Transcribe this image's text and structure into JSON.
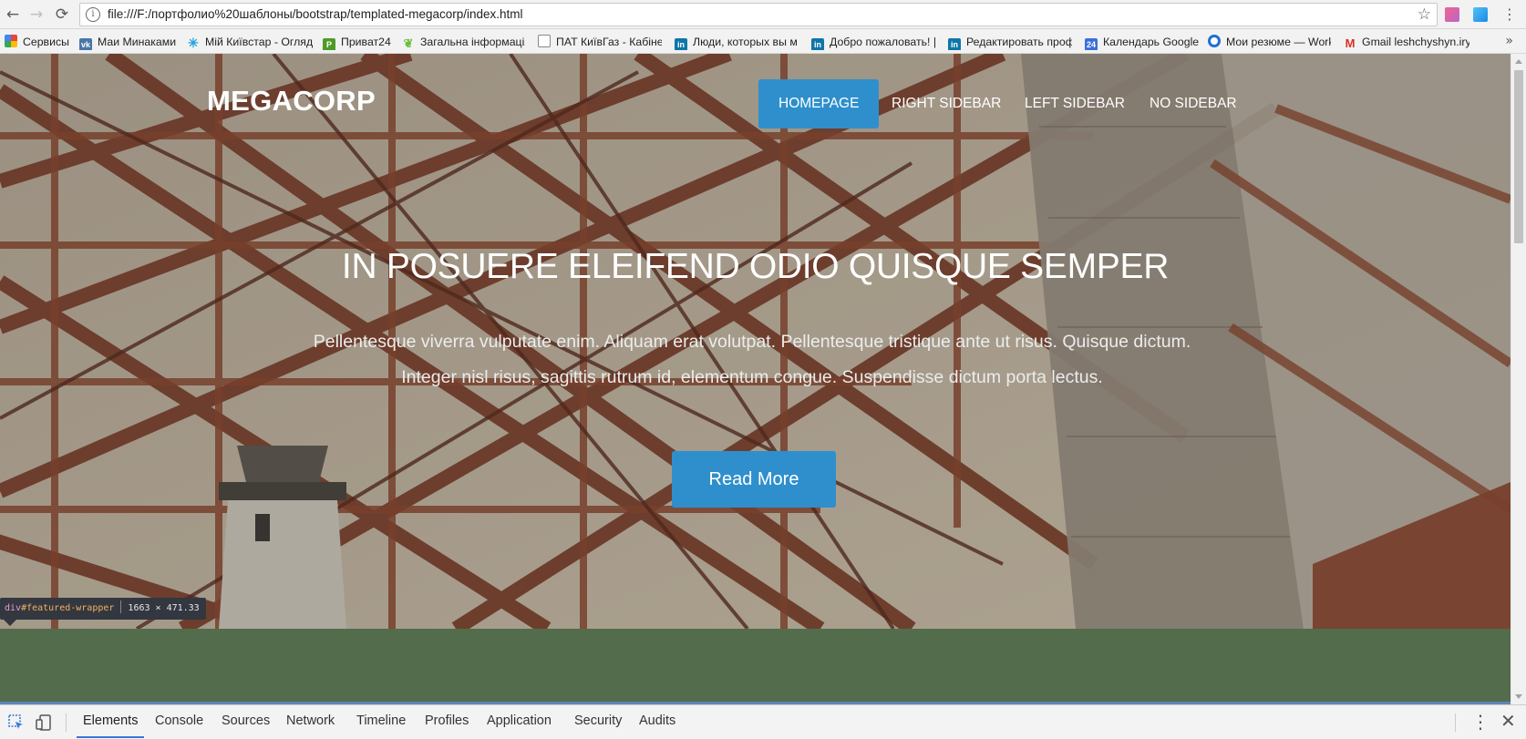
{
  "browser": {
    "url": "file:///F:/портфолио%20шаблоны/bootstrap/templated-megacorp/index.html",
    "nav": {
      "back_icon": "←",
      "forward_icon": "→",
      "reload_icon": "⟳",
      "info_icon": "i",
      "star_icon": "☆"
    },
    "bookmarks": [
      {
        "label": "Сервисы",
        "icon": "apps-icon",
        "color": "#e8453c"
      },
      {
        "label": "Маи Минаками",
        "icon": "vk-icon",
        "color": "#4a76a8"
      },
      {
        "label": "Мій Київстар - Огляд",
        "icon": "kyivstar-icon",
        "color": "#1fa3dc"
      },
      {
        "label": "Приват24",
        "icon": "privat24-icon",
        "color": "#4f9a28"
      },
      {
        "label": "Загальна інформація",
        "icon": "leaf-icon",
        "color": "#6bbf3a"
      },
      {
        "label": "ПАТ КиївГаз - Кабіне",
        "icon": "page-icon",
        "color": "#8a8a8a"
      },
      {
        "label": "Люди, которых вы м",
        "icon": "linkedin-icon",
        "color": "#0e76a8"
      },
      {
        "label": "Добро пожаловать! |",
        "icon": "linkedin-icon",
        "color": "#0e76a8"
      },
      {
        "label": "Редактировать проф",
        "icon": "linkedin-icon",
        "color": "#0e76a8"
      },
      {
        "label": "Календарь Google",
        "icon": "calendar-icon",
        "color": "#3d6fd8"
      },
      {
        "label": "Мои резюме — Work",
        "icon": "work-icon",
        "color": "#1f6fd6"
      },
      {
        "label": "Gmail leshchyshyn.iry",
        "icon": "gmail-icon",
        "color": "#d93025"
      }
    ],
    "bookmarks_overflow": "»"
  },
  "site": {
    "logo": "MEGACORP",
    "nav": [
      {
        "label": "Homepage",
        "active": true
      },
      {
        "label": "Right Sidebar",
        "active": false
      },
      {
        "label": "Left Sidebar",
        "active": false
      },
      {
        "label": "No Sidebar",
        "active": false
      }
    ],
    "hero": {
      "title": "IN POSUERE ELEIFEND ODIO QUISQUE SEMPER",
      "text": "Pellentesque viverra vulputate enim. Aliquam erat volutpat. Pellentesque tristique ante ut risus. Quisque dictum. Integer nisl risus, sagittis rutrum id, elementum congue. Suspendisse dictum porta lectus.",
      "button": "Read More"
    },
    "colors": {
      "accent": "#2e8fcc",
      "band": "#536c4b"
    }
  },
  "inspector_tooltip": {
    "tag": "div",
    "id": "#featured-wrapper",
    "dimensions": "1663 × 471.33"
  },
  "devtools": {
    "tabs": [
      "Elements",
      "Console",
      "Sources",
      "Network",
      "Timeline",
      "Profiles",
      "Application",
      "Security",
      "Audits"
    ],
    "active_tab": "Elements",
    "menu_icon": "⋮",
    "close_icon": "✕"
  }
}
